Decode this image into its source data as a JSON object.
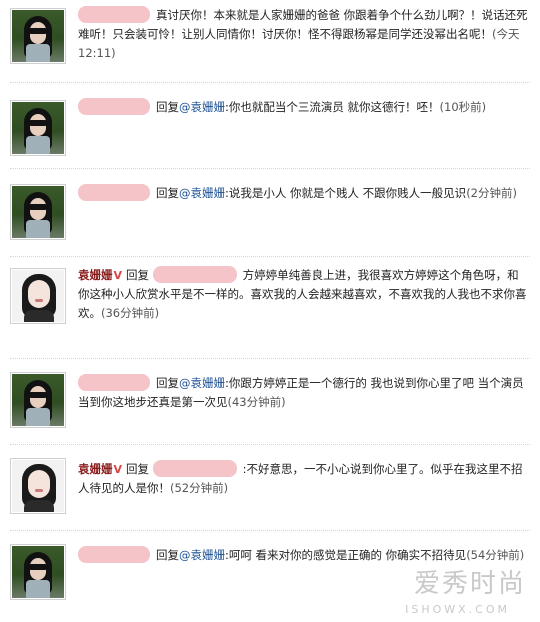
{
  "comments": [
    {
      "reply_prefix": "",
      "mention": "",
      "text": "真讨厌你！本来就是人家姗姗的爸爸 你跟着争个什么劲儿啊？！说话还死难听！只会装可怜！让别人同情你！讨厌你！怪不得跟杨幂是同学还没幂出名呢！",
      "time": "(今天 12:11)"
    },
    {
      "reply_prefix": "回复",
      "mention": "@袁姗姗",
      "text": ":你也就配当个三流演员 就你这德行！呸！",
      "time": "(10秒前)"
    },
    {
      "reply_prefix": "回复",
      "mention": "@袁姗姗",
      "text": ":说我是小人 你就是个贱人 不跟你贱人一般见识",
      "time": "(2分钟前)"
    },
    {
      "author": "袁姗姗",
      "badge": "V",
      "reply_prefix": "回复",
      "text": "方婷婷单纯善良上进，我很喜欢方婷婷这个角色呀，和你这种小人欣赏水平是不一样的。喜欢我的人会越来越喜欢，不喜欢我的人我也不求你喜欢。",
      "time": "(36分钟前)"
    },
    {
      "reply_prefix": "回复",
      "mention": "@袁姗姗",
      "text": ":你跟方婷婷正是一个德行的 我也说到你心里了吧 当个演员当到你这地步还真是第一次见",
      "time": "(43分钟前)"
    },
    {
      "author": "袁姗姗",
      "badge": "V",
      "reply_prefix": "回复",
      "text": ":不好意思，一不小心说到你心里了。似乎在我这里不招人待见的人是你！",
      "time": "(52分钟前)"
    },
    {
      "reply_prefix": "回复",
      "mention": "@袁姗姗",
      "text": ":呵呵 看来对你的感觉是正确的 你确实不招待见",
      "time": "(54分钟前)"
    }
  ],
  "watermark": {
    "title": "爱秀时尚",
    "url": "ISHOWX.COM"
  }
}
